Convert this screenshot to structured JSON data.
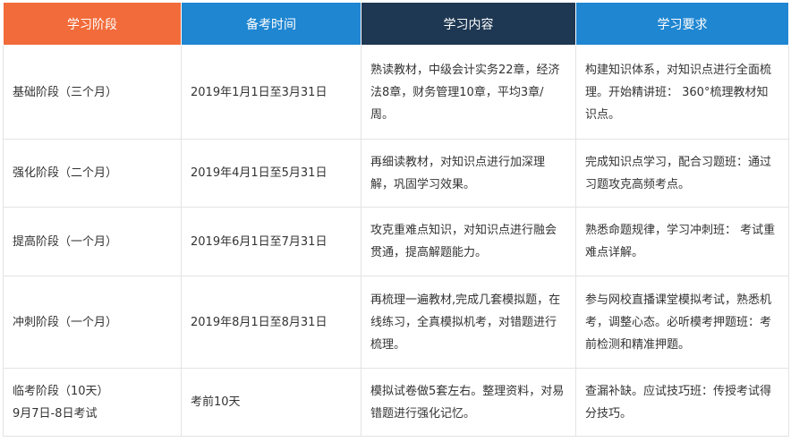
{
  "headers": [
    "学习阶段",
    "备考时间",
    "学习内容",
    "学习要求"
  ],
  "colors": {
    "header_stage": "#f26b3a",
    "header_time": "#1f86d1",
    "header_content": "#1e3752",
    "header_requirement": "#1f86d1"
  },
  "rows": [
    {
      "stage": "基础阶段（三个月）",
      "stage_note": "",
      "time": "2019年1月1日至3月31日",
      "content": "熟读教材，中级会计实务22章，经济法8章，财务管理10章，平均3章/周。",
      "requirement": "构建知识体系，对知识点进行全面梳理。开始精讲班： 360°梳理教材知识点。"
    },
    {
      "stage": "强化阶段（二个月）",
      "stage_note": "",
      "time": "2019年4月1日至5月31日",
      "content": "再细读教材，对知识点进行加深理解，巩固学习效果。",
      "requirement": "完成知识点学习，配合习题班：通过习题攻克高频考点。"
    },
    {
      "stage": "提高阶段（一个月）",
      "stage_note": "",
      "time": "2019年6月1日至7月31日",
      "content": "攻克重难点知识，对知识点进行融会贯通，提高解题能力。",
      "requirement": "熟悉命题规律，学习冲刺班： 考试重难点详解。"
    },
    {
      "stage": "冲刺阶段（一个月）",
      "stage_note": "",
      "time": "2019年8月1日至8月31日",
      "content": "再梳理一遍教材,完成几套模拟题，在线练习，全真模拟机考，对错题进行梳理。",
      "requirement": "参与网校直播课堂模拟考试，熟悉机考，调整心态。必听模考押题班：考前检测和精准押题。"
    },
    {
      "stage": "临考阶段（10天）",
      "stage_note": "9月7日-8日考试",
      "time": "考前10天",
      "content": "模拟试卷做5套左右。整理资料，对易错题进行强化记忆。",
      "requirement": "查漏补缺。应试技巧班：传授考试得分技巧。"
    }
  ]
}
